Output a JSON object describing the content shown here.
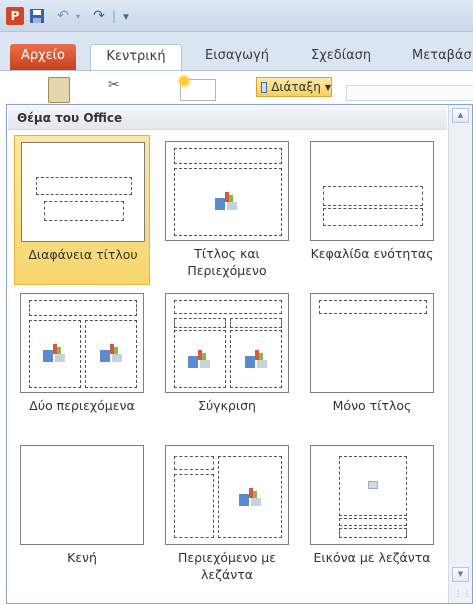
{
  "qat": {
    "logo_letter": "P",
    "more": "▾"
  },
  "tabs": {
    "file": "Αρχείο",
    "home": "Κεντρική",
    "insert": "Εισαγωγή",
    "design": "Σχεδίαση",
    "transitions": "Μεταβάσ"
  },
  "ribbon": {
    "layout_label": "Διάταξη"
  },
  "gallery": {
    "header": "Θέμα του Office",
    "selected_color": "#f7d66e",
    "items": [
      {
        "label": "Διαφάνεια τίτλου"
      },
      {
        "label": "Τίτλος και Περιεχόμενο"
      },
      {
        "label": "Κεφαλίδα ενότητας"
      },
      {
        "label": "Δύο περιεχόμενα"
      },
      {
        "label": "Σύγκριση"
      },
      {
        "label": "Μόνο τίτλος"
      },
      {
        "label": "Κενή"
      },
      {
        "label": "Περιεχόμενο με λεζάντα"
      },
      {
        "label": "Εικόνα με λεζάντα"
      }
    ]
  }
}
